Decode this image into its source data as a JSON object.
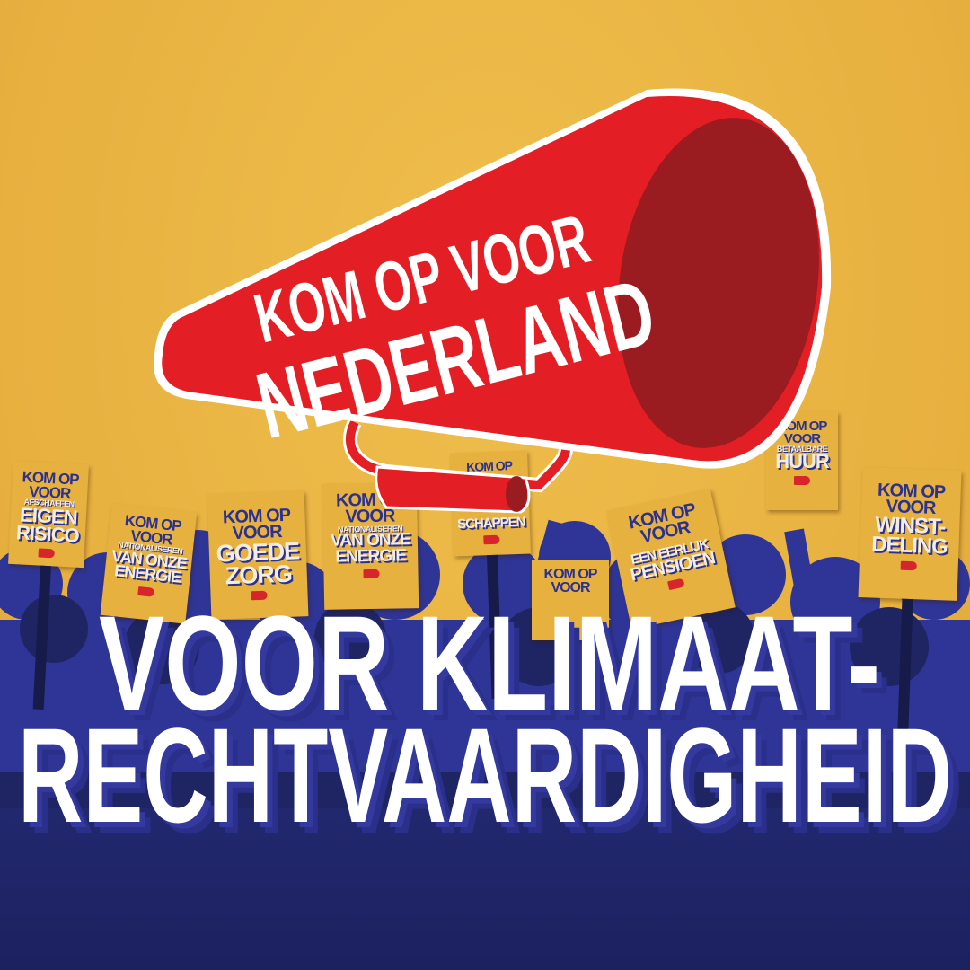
{
  "colors": {
    "background": "#e8b443",
    "navy": "#2b3190",
    "red": "#e31e24",
    "dark_red": "#9b1c20",
    "white": "#ffffff"
  },
  "megaphone": {
    "line1": "KOM OP VOOR",
    "line2": "NEDERLAND"
  },
  "signs": [
    {
      "top": "KOM OP",
      "mid": "VOOR",
      "small": "AFSCHAFFEN",
      "big1": "EIGEN",
      "big2": "RISICO"
    },
    {
      "top": "KOM OP",
      "mid": "VOOR",
      "small": "NATIONALISEREN",
      "big1": "VAN ONZE",
      "big2": "ENERGIE"
    },
    {
      "top": "KOM OP",
      "mid": "VOOR",
      "small": "",
      "big1": "GOEDE",
      "big2": "ZORG"
    },
    {
      "top": "KOM OP",
      "mid": "VOOR",
      "small": "NATIONALISEREN",
      "big1": "VAN ONZE",
      "big2": "ENERGIE"
    },
    {
      "top": "KOM OP",
      "mid": "",
      "small": "",
      "big1": "",
      "big2": "SCHAPPEN"
    },
    {
      "top": "KOM OP",
      "mid": "VOOR",
      "small": "",
      "big1": "",
      "big2": ""
    },
    {
      "top": "KOM OP",
      "mid": "VOOR",
      "small": "",
      "big1": "EEN EERLIJK",
      "big2": "PENSIOEN"
    },
    {
      "top": "KOM OP",
      "mid": "VOOR",
      "small": "BETAALBARE",
      "big1": "HUUR",
      "big2": ""
    },
    {
      "top": "KOM OP",
      "mid": "VOOR",
      "small": "",
      "big1": "WINST-",
      "big2": "DELING"
    }
  ],
  "headline": {
    "line1": "VOOR KLIMAAT-",
    "line2": "RECHTVAARDIGHEID"
  }
}
